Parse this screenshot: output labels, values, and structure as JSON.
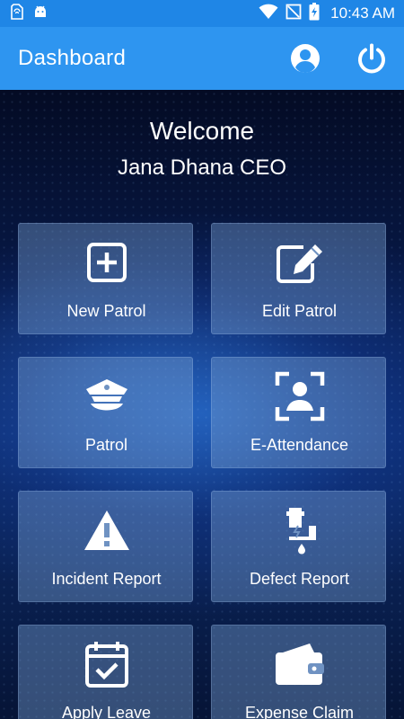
{
  "status_bar": {
    "time": "10:43 AM",
    "left_icons": [
      "sim-card-icon",
      "android-icon"
    ],
    "right_icons": [
      "wifi-icon",
      "no-signal-icon",
      "battery-charging-icon"
    ]
  },
  "appbar": {
    "title": "Dashboard",
    "actions": [
      "profile-icon",
      "power-icon"
    ]
  },
  "welcome": {
    "greeting": "Welcome",
    "user_name": "Jana Dhana CEO"
  },
  "tiles": [
    {
      "label": "New Patrol",
      "icon": "add-square-icon"
    },
    {
      "label": "Edit Patrol",
      "icon": "edit-icon"
    },
    {
      "label": "Patrol",
      "icon": "police-cap-icon"
    },
    {
      "label": "E-Attendance",
      "icon": "face-scan-icon"
    },
    {
      "label": "Incident Report",
      "icon": "warning-icon"
    },
    {
      "label": "Defect Report",
      "icon": "leaking-pipe-icon"
    },
    {
      "label": "Apply Leave",
      "icon": "calendar-check-icon"
    },
    {
      "label": "Expense Claim",
      "icon": "wallet-icon"
    }
  ],
  "colors": {
    "status_bar": "#1f86e6",
    "appbar": "#2e95f0",
    "background": "#050d2a",
    "tile": "#6f92c2"
  }
}
